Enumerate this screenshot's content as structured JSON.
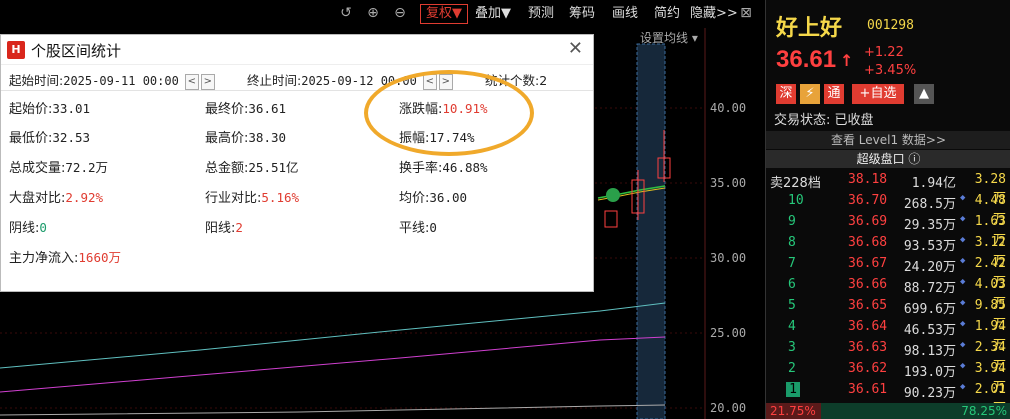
{
  "toolbar": {
    "undo_icon": "undo-icon",
    "zoom_in_icon": "zoom-in-icon",
    "zoom_out_icon": "zoom-out-icon",
    "buttons": [
      "复权▼",
      "叠加▼",
      "预测",
      "筹码",
      "画线",
      "简约",
      "隐藏>>"
    ],
    "close_icon": "close-icon"
  },
  "chart": {
    "set_ma_label": "设置均线 ▾",
    "y_labels": [
      "40.00",
      "35.00",
      "30.00",
      "25.00",
      "20.00"
    ]
  },
  "dialog": {
    "title": "个股区间统计",
    "logo": "H",
    "start_label": "起始时间:",
    "start_value": "2025-09-11 00:00",
    "end_label": "终止时间:",
    "end_value": "2025-09-12 00:00",
    "count_label": "统计个数:",
    "count_value": "2",
    "cells": [
      {
        "label": "起始价:",
        "value": "33.01",
        "color": "#222"
      },
      {
        "label": "最终价:",
        "value": "36.61",
        "color": "#222"
      },
      {
        "label": "涨跌幅:",
        "value": "10.91%",
        "color": "#e03c31"
      },
      {
        "label": "最低价:",
        "value": "32.53",
        "color": "#222"
      },
      {
        "label": "最高价:",
        "value": "38.30",
        "color": "#222"
      },
      {
        "label": "振幅:",
        "value": "17.74%",
        "color": "#222"
      },
      {
        "label": "总成交量:",
        "value": "72.2万",
        "color": "#222"
      },
      {
        "label": "总金额:",
        "value": "25.51亿",
        "color": "#222"
      },
      {
        "label": "换手率:",
        "value": "46.88%",
        "color": "#222"
      },
      {
        "label": "大盘对比:",
        "value": "2.92%",
        "color": "#e03c31"
      },
      {
        "label": "行业对比:",
        "value": "5.16%",
        "color": "#e03c31"
      },
      {
        "label": "均价:",
        "value": "36.00",
        "color": "#222"
      },
      {
        "label": "阴线:",
        "value": "0",
        "color": "#1a9b6a"
      },
      {
        "label": "阳线:",
        "value": "2",
        "color": "#e03c31"
      },
      {
        "label": "平线:",
        "value": "0",
        "color": "#222"
      },
      {
        "label": "主力净流入:",
        "value": "1660万",
        "color": "#e03c31"
      }
    ]
  },
  "panel": {
    "name": "好上好",
    "code": "001298",
    "price": "36.61",
    "change": "+1.22",
    "change_pct": "+3.45%",
    "tags": [
      {
        "label": "深",
        "color": "#e03c31"
      },
      {
        "label": "⚡",
        "color": "#e8a33a"
      },
      {
        "label": "通",
        "color": "#e03c31"
      },
      {
        "label": "+自选",
        "color": "#e03c31"
      }
    ],
    "status": "交易状态: 已收盘",
    "level1": "查看 Level1 数据>>",
    "superbox": "超级盘口 ⓘ",
    "sell_label": "卖228档",
    "sell_price": "38.18",
    "sell_vol": "1.94亿",
    "sell_vol2": "3.28万",
    "orders": [
      {
        "level": "10",
        "price": "36.70",
        "vol": "268.5万",
        "vol2": "4.48万"
      },
      {
        "level": "9",
        "price": "36.69",
        "vol": "29.35万",
        "vol2": "1.63万"
      },
      {
        "level": "8",
        "price": "36.68",
        "vol": "93.53万",
        "vol2": "3.12万"
      },
      {
        "level": "7",
        "price": "36.67",
        "vol": "24.20万",
        "vol2": "2.42万"
      },
      {
        "level": "6",
        "price": "36.66",
        "vol": "88.72万",
        "vol2": "4.03万"
      },
      {
        "level": "5",
        "price": "36.65",
        "vol": "699.6万",
        "vol2": "9.85万"
      },
      {
        "level": "4",
        "price": "36.64",
        "vol": "46.53万",
        "vol2": "1.94万"
      },
      {
        "level": "3",
        "price": "36.63",
        "vol": "98.13万",
        "vol2": "2.34万"
      },
      {
        "level": "2",
        "price": "36.62",
        "vol": "193.0万",
        "vol2": "3.94万"
      },
      {
        "level": "1",
        "price": "36.61",
        "vol": "90.23万",
        "vol2": "2.01万"
      }
    ],
    "bottom_left": "21.75%",
    "bottom_right": "78.25%"
  }
}
